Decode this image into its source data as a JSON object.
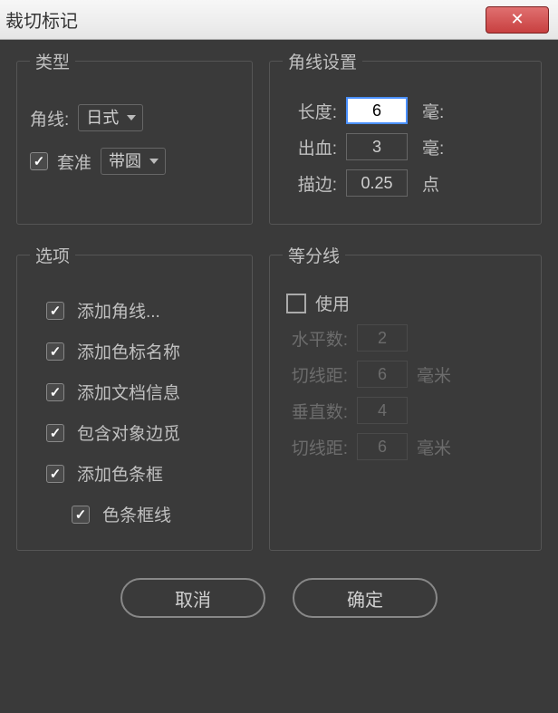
{
  "window": {
    "title": "裁切标记"
  },
  "type_group": {
    "legend": "类型",
    "corner_label": "角线:",
    "corner_style": "日式",
    "reg_label": "套准",
    "reg_style": "带圆"
  },
  "corner_group": {
    "legend": "角线设置",
    "length_label": "长度:",
    "length_value": "6",
    "length_unit": "毫:",
    "bleed_label": "出血:",
    "bleed_value": "3",
    "bleed_unit": "毫:",
    "stroke_label": "描边:",
    "stroke_value": "0.25",
    "stroke_unit": "点"
  },
  "options_group": {
    "legend": "选项",
    "items": [
      "添加角线...",
      "添加色标名称",
      "添加文档信息",
      "包含对象边觅",
      "添加色条框",
      "色条框线"
    ]
  },
  "division_group": {
    "legend": "等分线",
    "use_label": "使用",
    "h_count_label": "水平数:",
    "h_count_value": "2",
    "h_dist_label": "切线距:",
    "h_dist_value": "6",
    "h_dist_unit": "毫米",
    "v_count_label": "垂直数:",
    "v_count_value": "4",
    "v_dist_label": "切线距:",
    "v_dist_value": "6",
    "v_dist_unit": "毫米"
  },
  "buttons": {
    "cancel": "取消",
    "ok": "确定"
  }
}
